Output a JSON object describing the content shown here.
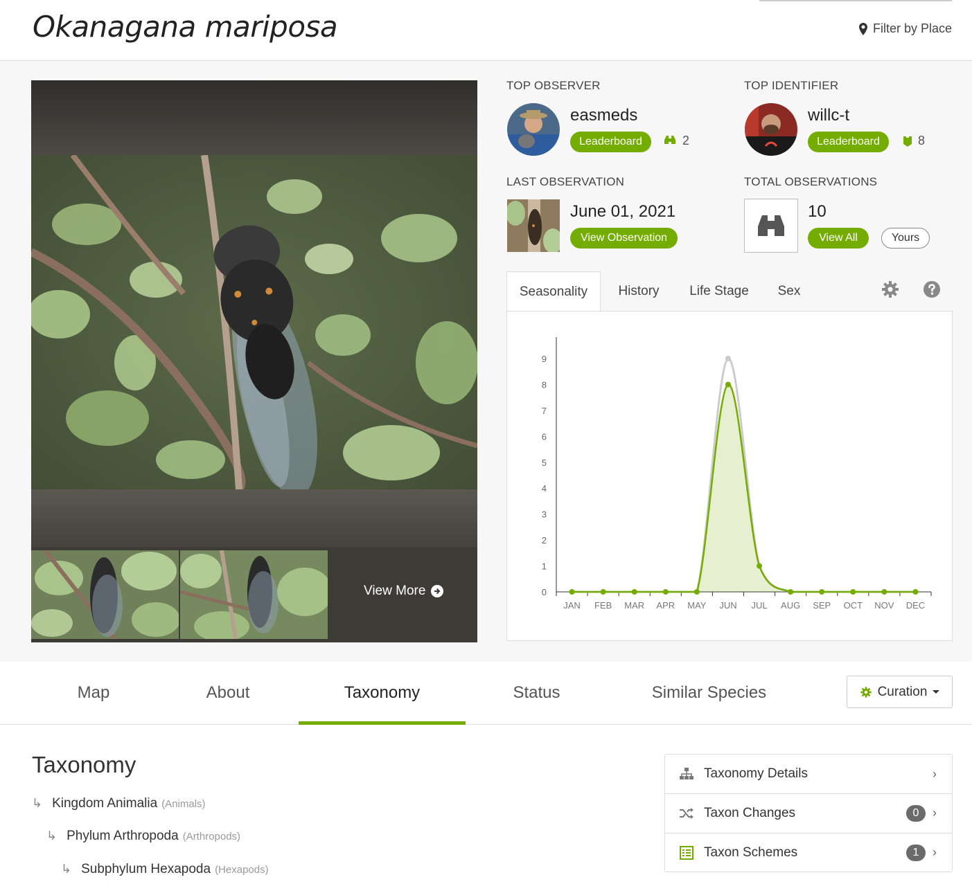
{
  "header": {
    "title": "Okanagana mariposa",
    "filter_label": "Filter by Place"
  },
  "photos": {
    "view_more_label": "View More"
  },
  "top_observer": {
    "label": "TOP OBSERVER",
    "name": "easmeds",
    "leaderboard_label": "Leaderboard",
    "count": "2"
  },
  "top_identifier": {
    "label": "TOP IDENTIFIER",
    "name": "willc-t",
    "leaderboard_label": "Leaderboard",
    "count": "8"
  },
  "last_observation": {
    "label": "LAST OBSERVATION",
    "date": "June 01, 2021",
    "button_label": "View Observation"
  },
  "total_observations": {
    "label": "TOTAL OBSERVATIONS",
    "count": "10",
    "view_all_label": "View All",
    "yours_label": "Yours"
  },
  "chart_tabs": [
    "Seasonality",
    "History",
    "Life Stage",
    "Sex"
  ],
  "chart_data": {
    "type": "area",
    "categories": [
      "JAN",
      "FEB",
      "MAR",
      "APR",
      "MAY",
      "JUN",
      "JUL",
      "AUG",
      "SEP",
      "OCT",
      "NOV",
      "DEC"
    ],
    "y_ticks": [
      "0",
      "1",
      "2",
      "3",
      "4",
      "5",
      "6",
      "7",
      "8",
      "9"
    ],
    "ylim": [
      0,
      9
    ],
    "series": [
      {
        "values": [
          0,
          0,
          0,
          0,
          0,
          9,
          1,
          0,
          0,
          0,
          0,
          0
        ],
        "color": "#cccccc"
      },
      {
        "values": [
          0,
          0,
          0,
          0,
          0,
          8,
          1,
          0,
          0,
          0,
          0,
          0
        ],
        "color": "#74ac00"
      }
    ],
    "grid": false
  },
  "tabs": {
    "items": [
      "Map",
      "About",
      "Taxonomy",
      "Status",
      "Similar Species"
    ],
    "active": "Taxonomy",
    "curation_label": "Curation"
  },
  "taxonomy": {
    "title": "Taxonomy",
    "items": [
      {
        "name": "Kingdom Animalia",
        "common": "(Animals)"
      },
      {
        "name": "Phylum Arthropoda",
        "common": "(Arthropods)"
      },
      {
        "name": "Subphylum Hexapoda",
        "common": "(Hexapods)"
      }
    ]
  },
  "side_panel": {
    "items": [
      {
        "label": "Taxonomy Details",
        "icon": "sitemap-icon",
        "badge": ""
      },
      {
        "label": "Taxon Changes",
        "icon": "shuffle-icon",
        "badge": "0"
      },
      {
        "label": "Taxon Schemes",
        "icon": "list-icon",
        "badge": "1"
      }
    ]
  },
  "colors": {
    "accent": "#74ac00",
    "chart_gray": "#cccccc"
  },
  "icons": {
    "chevron": "›",
    "arrow": "↳"
  }
}
